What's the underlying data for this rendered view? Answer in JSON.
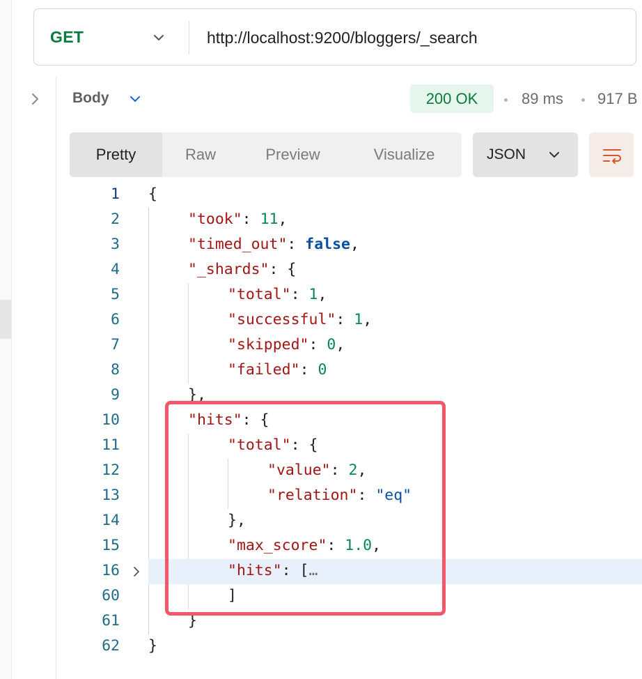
{
  "request": {
    "method": "GET",
    "url": "http://localhost:9200/bloggers/_search"
  },
  "response": {
    "body_label": "Body",
    "status": "200 OK",
    "time": "89 ms",
    "size": "917 B",
    "tabs": [
      {
        "label": "Pretty",
        "active": true
      },
      {
        "label": "Raw",
        "active": false
      },
      {
        "label": "Preview",
        "active": false
      },
      {
        "label": "Visualize",
        "active": false
      }
    ],
    "format": "JSON"
  },
  "code_lines": [
    {
      "num": "1",
      "tokens": [
        {
          "t": "p",
          "v": "{"
        }
      ]
    },
    {
      "num": "2",
      "tokens": [
        {
          "t": "k",
          "v": "\"took\""
        },
        {
          "t": "p",
          "v": ": "
        },
        {
          "t": "n",
          "v": "11"
        },
        {
          "t": "p",
          "v": ","
        }
      ]
    },
    {
      "num": "3",
      "tokens": [
        {
          "t": "k",
          "v": "\"timed_out\""
        },
        {
          "t": "p",
          "v": ": "
        },
        {
          "t": "b",
          "v": "false"
        },
        {
          "t": "p",
          "v": ","
        }
      ]
    },
    {
      "num": "4",
      "tokens": [
        {
          "t": "k",
          "v": "\"_shards\""
        },
        {
          "t": "p",
          "v": ": {"
        }
      ]
    },
    {
      "num": "5",
      "tokens": [
        {
          "t": "k",
          "v": "\"total\""
        },
        {
          "t": "p",
          "v": ": "
        },
        {
          "t": "n",
          "v": "1"
        },
        {
          "t": "p",
          "v": ","
        }
      ]
    },
    {
      "num": "6",
      "tokens": [
        {
          "t": "k",
          "v": "\"successful\""
        },
        {
          "t": "p",
          "v": ": "
        },
        {
          "t": "n",
          "v": "1"
        },
        {
          "t": "p",
          "v": ","
        }
      ]
    },
    {
      "num": "7",
      "tokens": [
        {
          "t": "k",
          "v": "\"skipped\""
        },
        {
          "t": "p",
          "v": ": "
        },
        {
          "t": "n",
          "v": "0"
        },
        {
          "t": "p",
          "v": ","
        }
      ]
    },
    {
      "num": "8",
      "tokens": [
        {
          "t": "k",
          "v": "\"failed\""
        },
        {
          "t": "p",
          "v": ": "
        },
        {
          "t": "n",
          "v": "0"
        }
      ]
    },
    {
      "num": "9",
      "tokens": [
        {
          "t": "p",
          "v": "},"
        }
      ]
    },
    {
      "num": "10",
      "tokens": [
        {
          "t": "k",
          "v": "\"hits\""
        },
        {
          "t": "p",
          "v": ": {"
        }
      ]
    },
    {
      "num": "11",
      "tokens": [
        {
          "t": "k",
          "v": "\"total\""
        },
        {
          "t": "p",
          "v": ": {"
        }
      ]
    },
    {
      "num": "12",
      "tokens": [
        {
          "t": "k",
          "v": "\"value\""
        },
        {
          "t": "p",
          "v": ": "
        },
        {
          "t": "n",
          "v": "2"
        },
        {
          "t": "p",
          "v": ","
        }
      ]
    },
    {
      "num": "13",
      "tokens": [
        {
          "t": "k",
          "v": "\"relation\""
        },
        {
          "t": "p",
          "v": ": "
        },
        {
          "t": "s",
          "v": "\"eq\""
        }
      ]
    },
    {
      "num": "14",
      "tokens": [
        {
          "t": "p",
          "v": "},"
        }
      ]
    },
    {
      "num": "15",
      "tokens": [
        {
          "t": "k",
          "v": "\"max_score\""
        },
        {
          "t": "p",
          "v": ": "
        },
        {
          "t": "n",
          "v": "1.0"
        },
        {
          "t": "p",
          "v": ","
        }
      ]
    },
    {
      "num": "16",
      "tokens": [
        {
          "t": "k",
          "v": "\"hits\""
        },
        {
          "t": "p",
          "v": ": ["
        },
        {
          "t": "e",
          "v": "…"
        }
      ]
    },
    {
      "num": "60",
      "tokens": [
        {
          "t": "p",
          "v": "]"
        }
      ]
    },
    {
      "num": "61",
      "tokens": [
        {
          "t": "p",
          "v": "}"
        }
      ]
    },
    {
      "num": "62",
      "tokens": [
        {
          "t": "p",
          "v": "}"
        }
      ]
    }
  ],
  "colors": {
    "method_green": "#0b7a3e",
    "status_bg": "#e7f6ec",
    "annotation_red": "#f4566a",
    "json_key": "#a31515",
    "json_number": "#098658",
    "json_string": "#0451a5"
  },
  "icons": {
    "method_dropdown": "chevron-down-icon",
    "expand": "chevron-right-icon",
    "body_dropdown": "chevron-down-icon",
    "format_dropdown": "chevron-down-icon",
    "wrap": "wrap-lines-icon",
    "fold": "chevron-right-icon"
  }
}
